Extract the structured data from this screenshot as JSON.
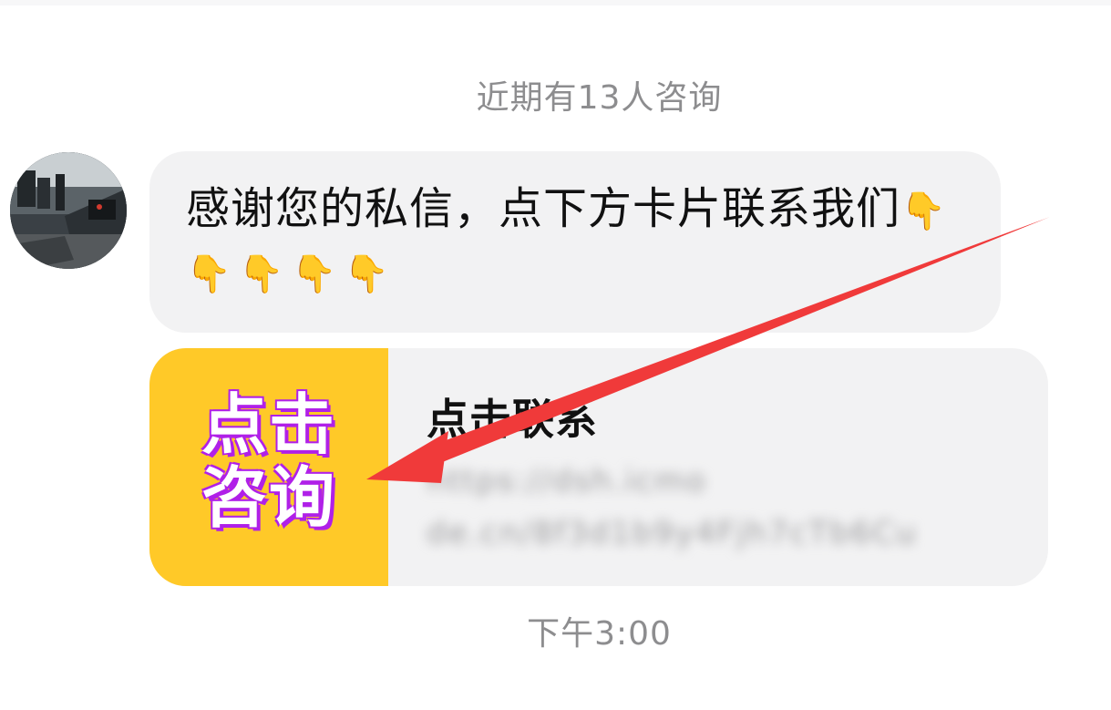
{
  "chat": {
    "consult_notice": "近期有13人咨询",
    "message": {
      "text": "感谢您的私信，点下方卡片联系我们",
      "emojis": "👇👇👇👇👇"
    },
    "card": {
      "thumbnail_line_1": "点击",
      "thumbnail_line_2": "咨询",
      "title": "点击联系",
      "link_line_1": "https://dsh.icmo",
      "link_line_2": "de.cn/8f3d1b9y4Fjh7cTb6Cu"
    },
    "timestamp": "下午3:00"
  },
  "colors": {
    "bubble": "#f2f2f3",
    "thumbnail_bg": "#ffc928",
    "thumbnail_text_shadow": "#b020e8",
    "arrow": "#f03a3a",
    "muted_text": "#8d8d8f"
  },
  "icons": {
    "avatar": "gym-photo-avatar",
    "annotation": "red-arrow-annotation"
  }
}
